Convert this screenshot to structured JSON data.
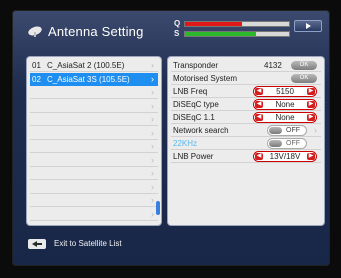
{
  "header": {
    "title": "Antenna Setting",
    "signal": {
      "q_label": "Q",
      "s_label": "S",
      "q_level": 0.55,
      "s_level": 0.68,
      "q_color": "#e01818",
      "s_color": "#2bb82b"
    },
    "nav_icon": "right-triangle-icon"
  },
  "satellite_list": [
    {
      "num": "01",
      "name": "C_AsiaSat 2 (100.5E)",
      "selected": false
    },
    {
      "num": "02",
      "name": "C_AsiaSat 3S (105.5E)",
      "selected": true
    },
    {
      "num": "",
      "name": "",
      "selected": false
    },
    {
      "num": "",
      "name": "",
      "selected": false
    },
    {
      "num": "",
      "name": "",
      "selected": false
    },
    {
      "num": "",
      "name": "",
      "selected": false
    },
    {
      "num": "",
      "name": "",
      "selected": false
    },
    {
      "num": "",
      "name": "",
      "selected": false
    },
    {
      "num": "",
      "name": "",
      "selected": false
    },
    {
      "num": "",
      "name": "",
      "selected": false
    },
    {
      "num": "",
      "name": "",
      "selected": false
    },
    {
      "num": "",
      "name": "",
      "selected": false
    }
  ],
  "settings": {
    "transponder": {
      "label": "Transponder",
      "value": "4132",
      "button": "OK"
    },
    "motorised": {
      "label": "Motorised System",
      "button": "OK"
    },
    "lnb_freq": {
      "label": "LNB Freq",
      "value": "5150"
    },
    "diseqc_type": {
      "label": "DiSEqC type",
      "value": "None"
    },
    "diseqc_11": {
      "label": "DiSEqC 1.1",
      "value": "None"
    },
    "network_search": {
      "label": "Network search",
      "value": "OFF"
    },
    "khz22": {
      "label": "22KHz",
      "value": "OFF"
    },
    "lnb_power": {
      "label": "LNB Power",
      "value": "13V/18V"
    }
  },
  "footer": {
    "back_label": "Exit to Satellite List"
  },
  "colors": {
    "selection_blue": "#1e8ff0",
    "selector_red": "#d41e1e",
    "cyan_label": "#58b8f0"
  }
}
